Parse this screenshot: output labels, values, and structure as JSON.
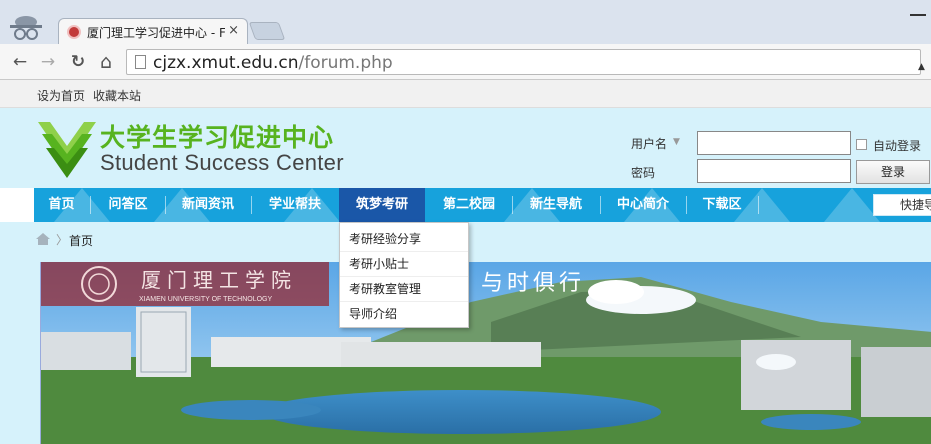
{
  "browser": {
    "tab_title": "厦门理工学习促进中心 - F",
    "tab_close": "×",
    "url_host": "cjzx.xmut.edu.cn",
    "url_path": "/forum.php",
    "back": "←",
    "forward": "→",
    "reload": "↻",
    "home": "⌂"
  },
  "topbar": {
    "set_home": "设为首页",
    "bookmark": "收藏本站"
  },
  "site": {
    "logo_cn": "大学生学习促进中心",
    "logo_en": "Student Success Center",
    "brand_green": "#57b31f"
  },
  "login": {
    "username_label": "用户名",
    "password_label": "密码",
    "remember_label": "自动登录",
    "submit_label": "登录",
    "username_value": "",
    "password_value": ""
  },
  "nav": {
    "items": [
      {
        "label": "首页"
      },
      {
        "label": "问答区"
      },
      {
        "label": "新闻资讯"
      },
      {
        "label": "学业帮扶"
      },
      {
        "label": "筑梦考研"
      },
      {
        "label": "第二校园"
      },
      {
        "label": "新生导航"
      },
      {
        "label": "中心简介"
      },
      {
        "label": "下载区"
      }
    ],
    "active_index": 4,
    "quick_label": "快捷导",
    "colors": {
      "bar": "#17a2dc",
      "active": "#1a57a8"
    }
  },
  "dropdown": {
    "items": [
      {
        "label": "考研经验分享"
      },
      {
        "label": "考研小贴士"
      },
      {
        "label": "考研教室管理"
      },
      {
        "label": "导师介绍"
      }
    ]
  },
  "breadcrumb": {
    "separator": "〉",
    "current": "首页"
  },
  "banner": {
    "school_cn": "厦门理工学院",
    "school_en": "XIAMEN UNIVERSITY OF TECHNOLOGY",
    "slogan": "与时俱行"
  }
}
